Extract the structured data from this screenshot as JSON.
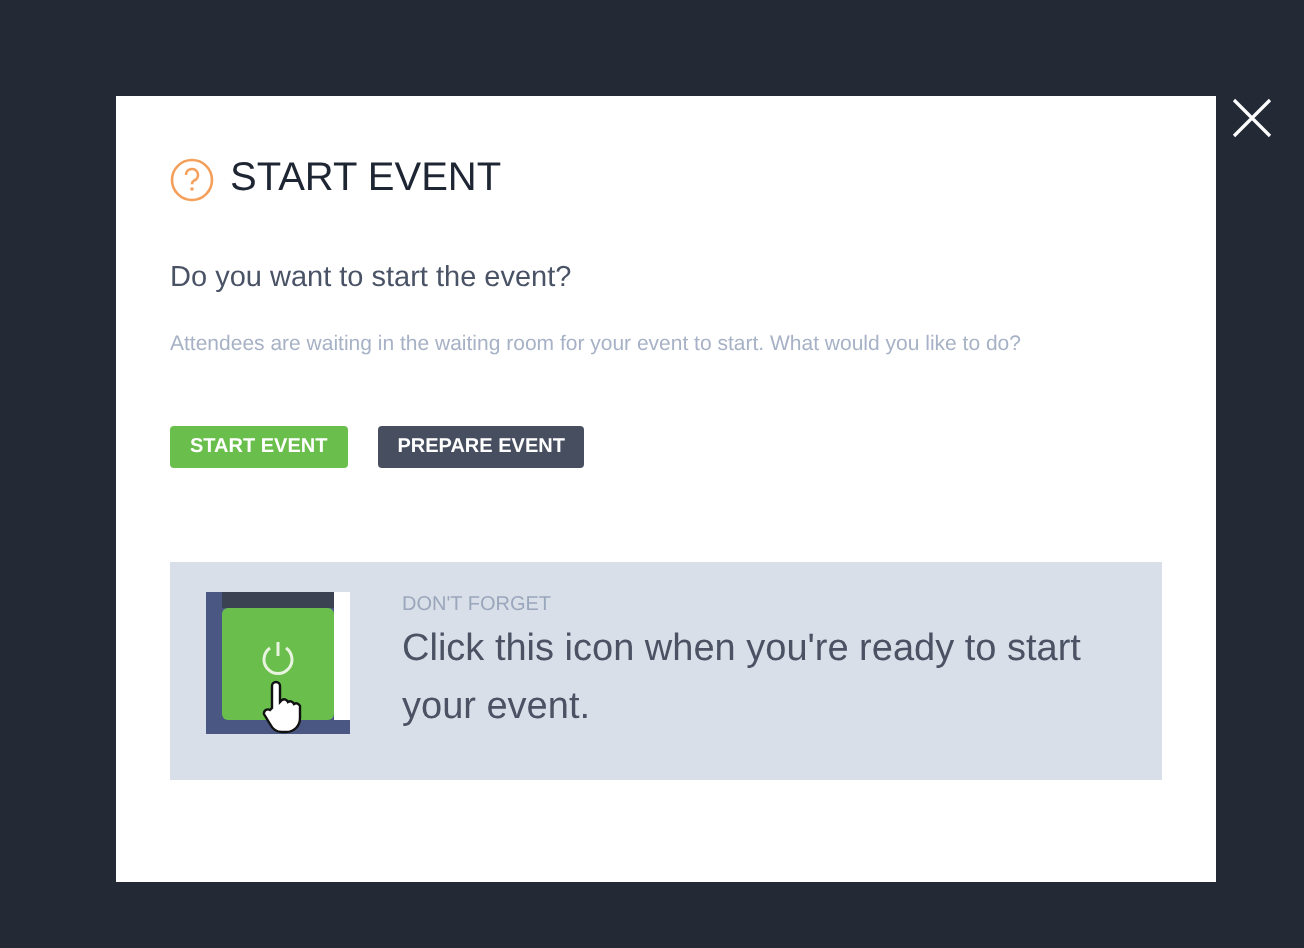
{
  "dialog": {
    "title": "START EVENT",
    "question": "Do you want to start the event?",
    "description": "Attendees are waiting in the waiting room for your event to start. What would you like to do?",
    "buttons": [
      {
        "label": "START EVENT",
        "kind": "primary"
      },
      {
        "label": "PREPARE EVENT",
        "kind": "secondary"
      }
    ],
    "tip": {
      "label": "DON'T FORGET",
      "text": "Click this icon when you're ready to start your event."
    }
  }
}
